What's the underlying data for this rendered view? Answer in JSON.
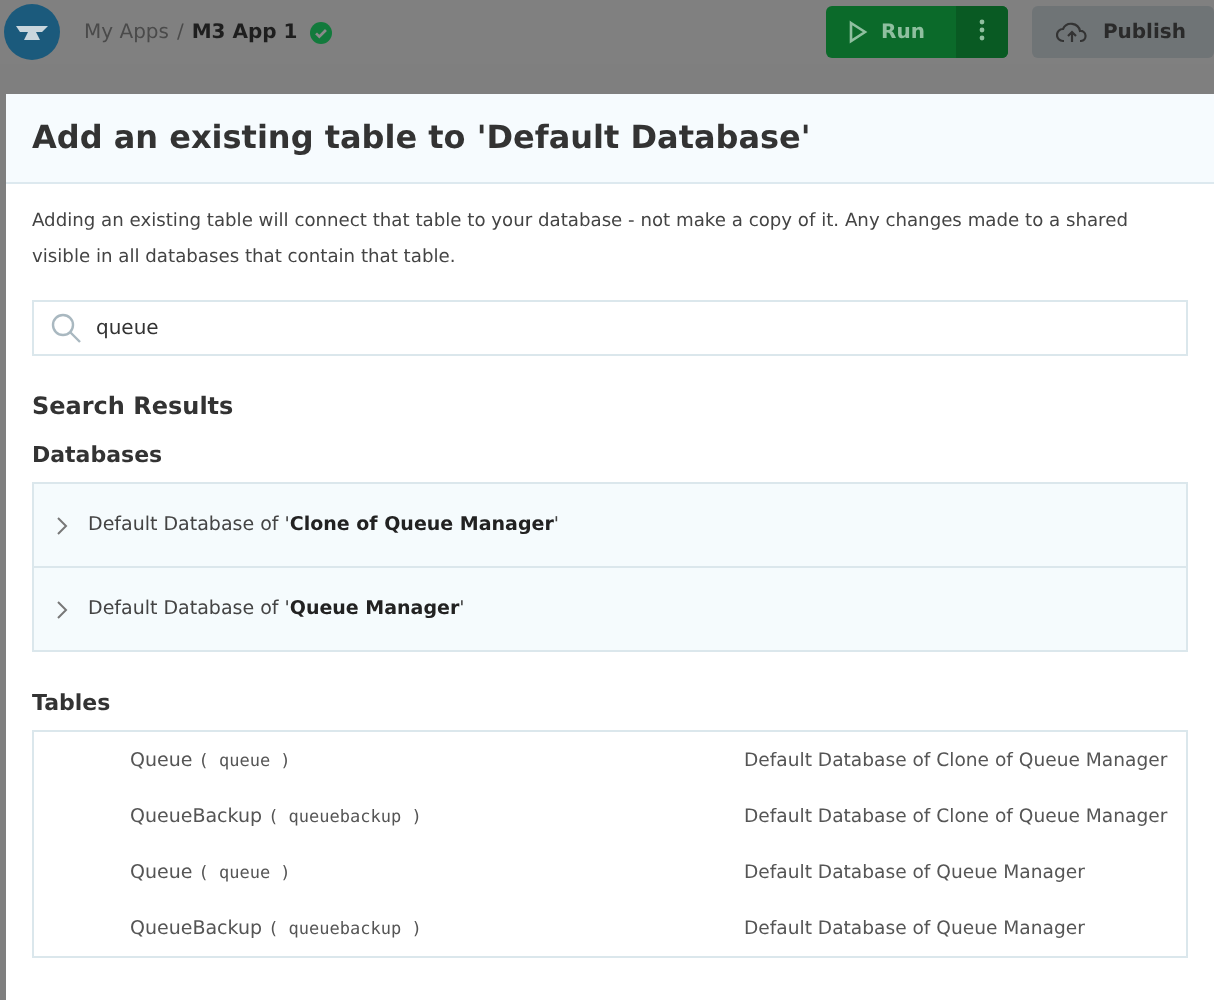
{
  "header": {
    "breadcrumb": {
      "parent": "My Apps",
      "separator": "/",
      "current": "M3 App 1"
    },
    "run_label": "Run",
    "publish_label": "Publish"
  },
  "dialog": {
    "title": "Add an existing table to 'Default Database'",
    "description_lines": [
      "Adding an existing table will connect that table to your database - not make a copy of it. Any changes made to a shared",
      "visible in all databases that contain that table."
    ],
    "search": {
      "value": "queue"
    },
    "results_heading": "Search Results",
    "databases_heading": "Databases",
    "databases": [
      {
        "label": "Default Database of '**Clone of Queue Manager**'",
        "expanded": false
      },
      {
        "label": "Default Database of '**Queue Manager**'",
        "expanded": false
      }
    ],
    "tables_heading": "Tables",
    "tables": [
      {
        "name": "Queue",
        "key": "( queue )",
        "database": "Default Database of Clone of Queue Manager"
      },
      {
        "name": "QueueBackup",
        "key": "( queuebackup )",
        "database": "Default Database of Clone of Queue Manager"
      },
      {
        "name": "Queue",
        "key": "( queue )",
        "database": "Default Database of Queue Manager"
      },
      {
        "name": "QueueBackup",
        "key": "( queuebackup )",
        "database": "Default Database of Queue Manager"
      }
    ]
  }
}
